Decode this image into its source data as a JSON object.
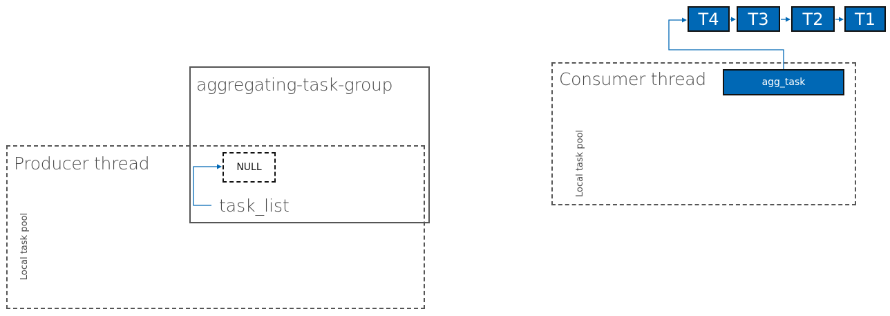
{
  "producer": {
    "title": "Producer thread",
    "pool_label": "Local task pool"
  },
  "group": {
    "title": "aggregating-task-group",
    "null_label": "NULL",
    "task_list_label": "task_list"
  },
  "consumer": {
    "title": "Consumer thread",
    "pool_label": "Local task pool",
    "agg_task_label": "agg_task"
  },
  "task_chain": [
    "T4",
    "T3",
    "T2",
    "T1"
  ],
  "colors": {
    "task_fill": "#0068b5",
    "arrow": "#0068b5",
    "outline": "#555555"
  }
}
